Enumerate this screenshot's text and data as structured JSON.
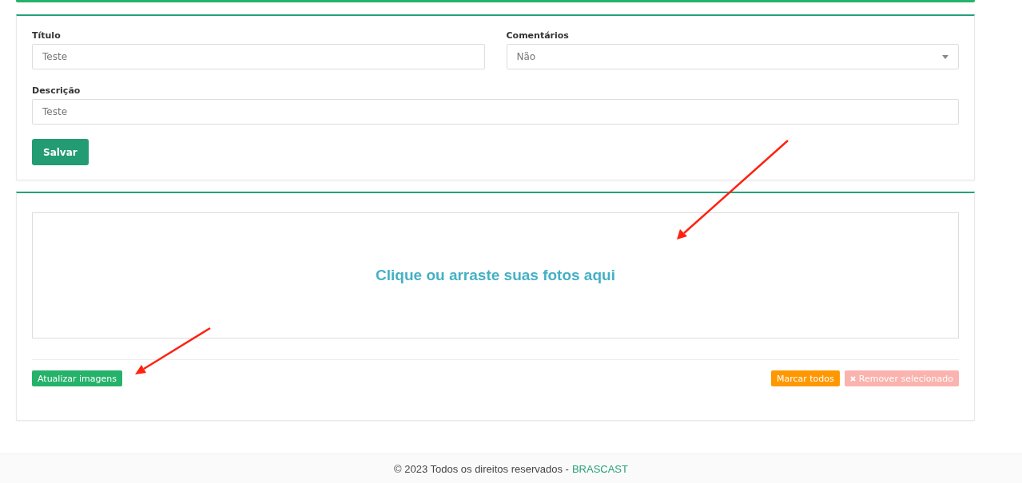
{
  "form": {
    "fields": [
      {
        "kind": "text",
        "label": "Título",
        "value": "Teste"
      },
      {
        "kind": "select",
        "label": "Comentários",
        "value": "Não"
      },
      {
        "kind": "text",
        "label": "Descrição",
        "value": "Teste"
      }
    ],
    "save_button": "Salvar"
  },
  "uploader": {
    "dropzone_text": "Clique ou arraste suas fotos aqui",
    "buttons": [
      {
        "label": "Atualizar imagens",
        "kind": "update",
        "disabled": false
      },
      {
        "label": "Marcar todos",
        "kind": "select_all",
        "disabled": false
      },
      {
        "label": "Remover selecionado",
        "kind": "remove",
        "disabled": true
      }
    ]
  },
  "footer": {
    "text": "© 2023 Todos os direitos reservados - ",
    "brand": "BRASCAST"
  }
}
